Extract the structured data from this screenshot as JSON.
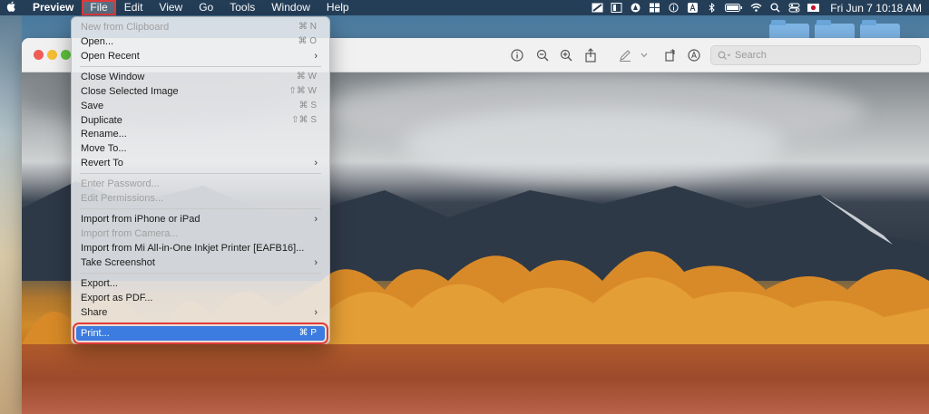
{
  "menubar": {
    "app_name": "Preview",
    "items": [
      "File",
      "Edit",
      "View",
      "Go",
      "Tools",
      "Window",
      "Help"
    ],
    "clock": "Fri Jun 7  10:18 AM",
    "status_icons": [
      "focus-icon",
      "notes-icon",
      "drop-icon",
      "grid-icon",
      "info-icon",
      "text-input-icon",
      "bluetooth-icon",
      "battery-icon",
      "wifi-icon",
      "search-icon",
      "control-center-icon",
      "flag-icon"
    ]
  },
  "toolbar": {
    "search_placeholder": "Search"
  },
  "file_menu": {
    "items": [
      {
        "label": "New from Clipboard",
        "shortcut": "⌘ N",
        "disabled": true
      },
      {
        "label": "Open...",
        "shortcut": "⌘ O"
      },
      {
        "label": "Open Recent",
        "submenu": true
      },
      {
        "label": "Close Window",
        "shortcut": "⌘ W"
      },
      {
        "label": "Close Selected Image",
        "shortcut": "⇧⌘ W"
      },
      {
        "label": "Save",
        "shortcut": "⌘ S"
      },
      {
        "label": "Duplicate",
        "shortcut": "⇧⌘ S"
      },
      {
        "label": "Rename..."
      },
      {
        "label": "Move To..."
      },
      {
        "label": "Revert To",
        "submenu": true
      },
      {
        "label": "Enter Password...",
        "disabled": true
      },
      {
        "label": "Edit Permissions...",
        "disabled": true
      },
      {
        "label": "Import from iPhone or iPad",
        "submenu": true
      },
      {
        "label": "Import from Camera...",
        "disabled": true
      },
      {
        "label": "Import from Mi All-in-One Inkjet Printer [EAFB16]..."
      },
      {
        "label": "Take Screenshot",
        "submenu": true
      },
      {
        "label": "Export..."
      },
      {
        "label": "Export as PDF..."
      },
      {
        "label": "Share",
        "submenu": true
      },
      {
        "label": "Print...",
        "shortcut": "⌘ P",
        "highlighted": true
      }
    ],
    "chevron": "›"
  },
  "colors": {
    "highlight": "#3c7be0",
    "annotation": "#e03a3a",
    "menubar": "#223a52"
  }
}
